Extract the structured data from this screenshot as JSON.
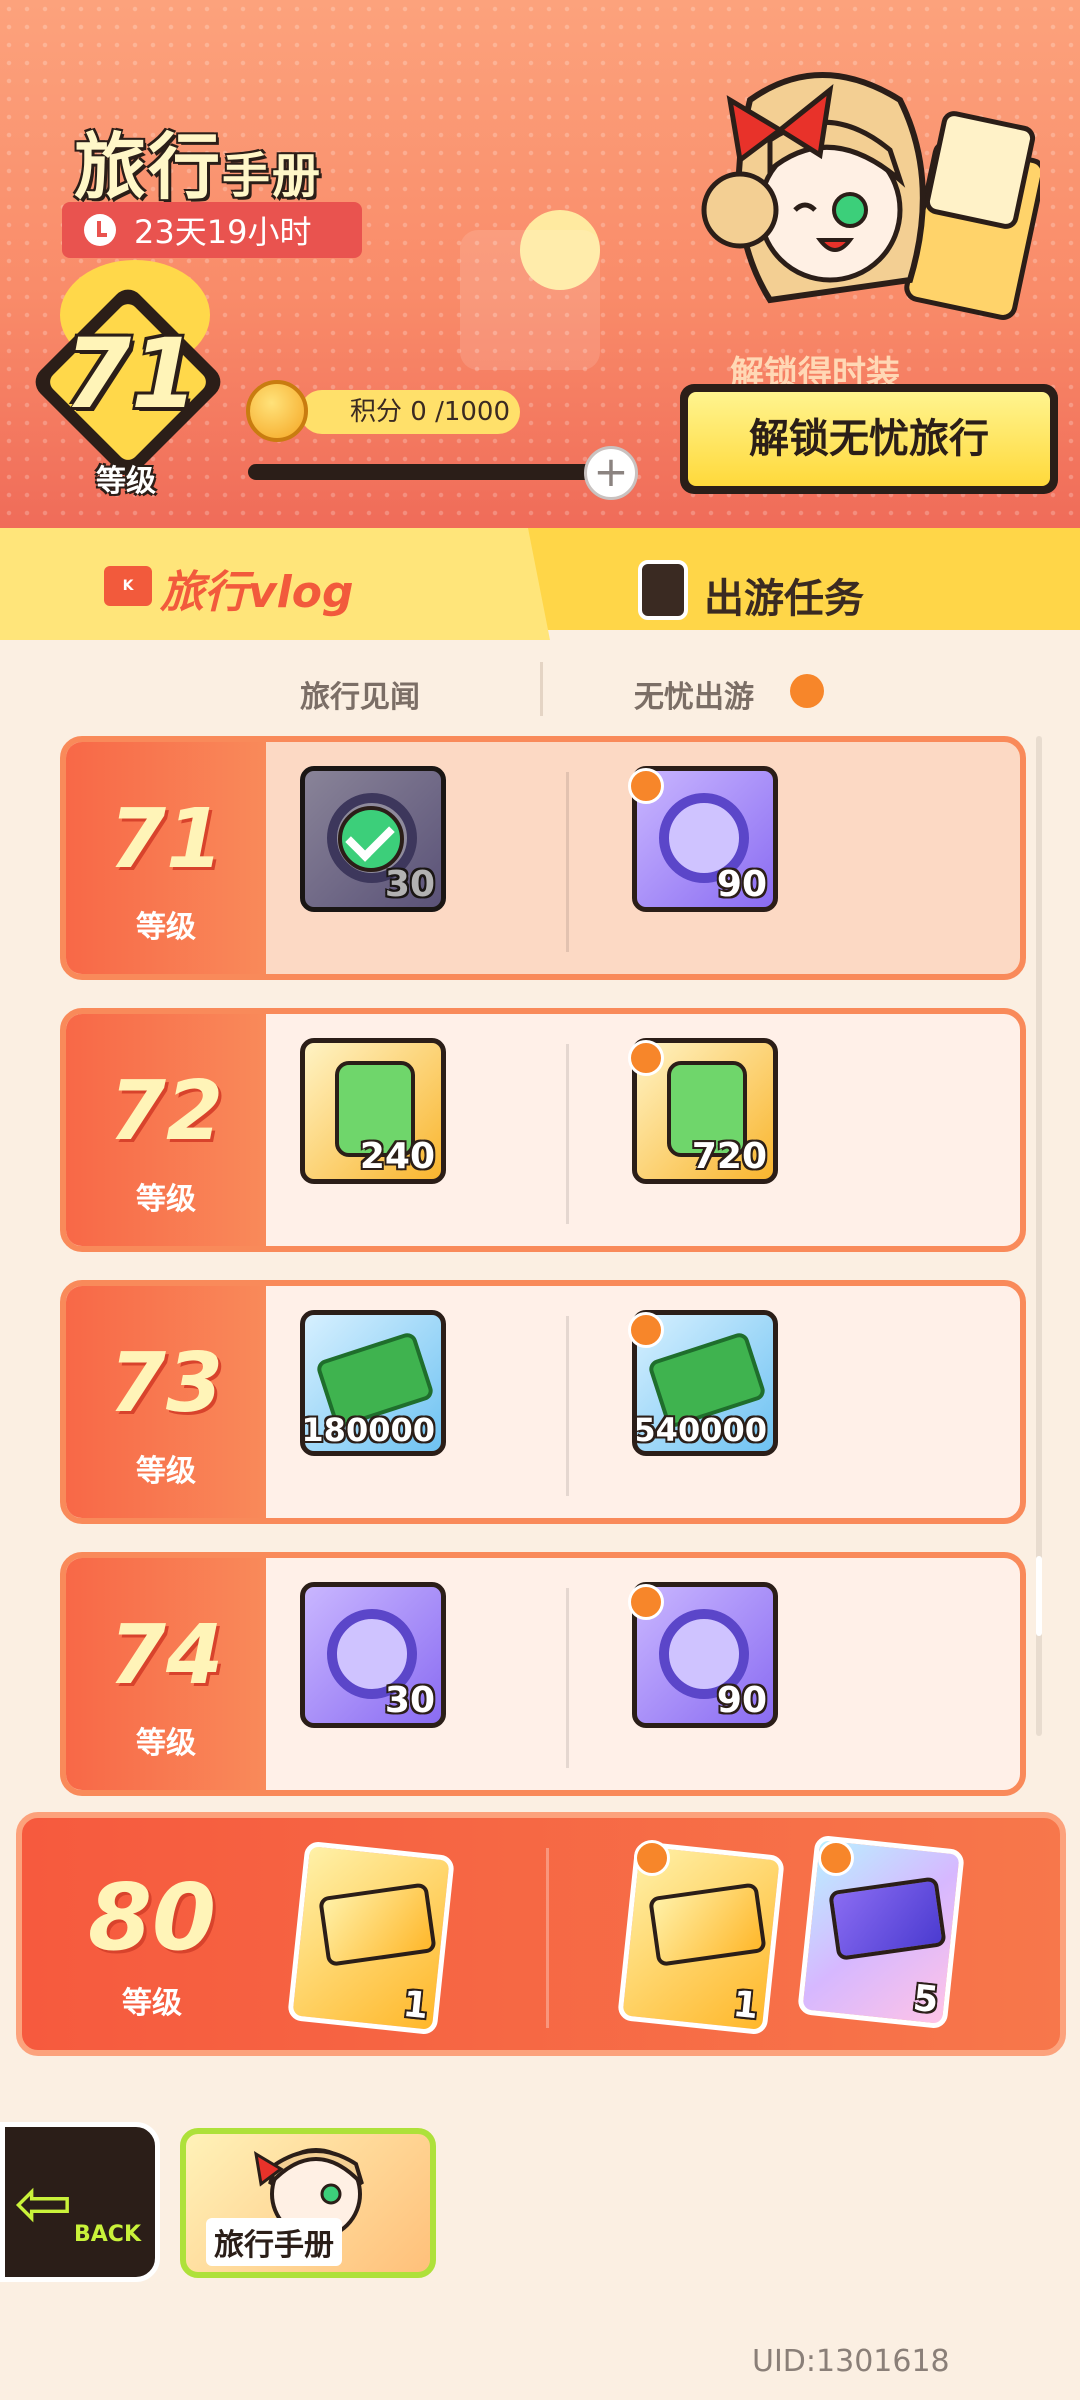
{
  "header": {
    "title_big": "旅行",
    "title_small": "手册",
    "timer": "23天19小时",
    "level": "71",
    "level_label": "等级",
    "points_label": "积分 0 /1000",
    "points_current": 0,
    "points_max": 1000,
    "progress": 0.0,
    "unlock_sub": "解锁得时装",
    "unlock_button": "解锁无忧旅行"
  },
  "tabs": {
    "vlog": "旅行vlog",
    "task": "出游任务"
  },
  "columns": {
    "left": "旅行见闻",
    "right": "无忧出游"
  },
  "rows": [
    {
      "level": "71",
      "label": "等级",
      "free_count": "30",
      "paid_count": "90"
    },
    {
      "level": "72",
      "label": "等级",
      "free_count": "240",
      "paid_count": "720"
    },
    {
      "level": "73",
      "label": "等级",
      "free_count": "180000",
      "paid_count": "540000"
    },
    {
      "level": "74",
      "label": "等级",
      "free_count": "30",
      "paid_count": "90"
    },
    {
      "level": "80",
      "label": "等级",
      "free_count": "1",
      "paid_count": "1",
      "paid_count_2": "5"
    }
  ],
  "bottom": {
    "back": "BACK",
    "journal": "旅行手册",
    "uid": "UID:1301618"
  },
  "colors": {
    "accent": "#f86847",
    "tab": "#ffd648",
    "text_dark": "#2b1e18"
  }
}
